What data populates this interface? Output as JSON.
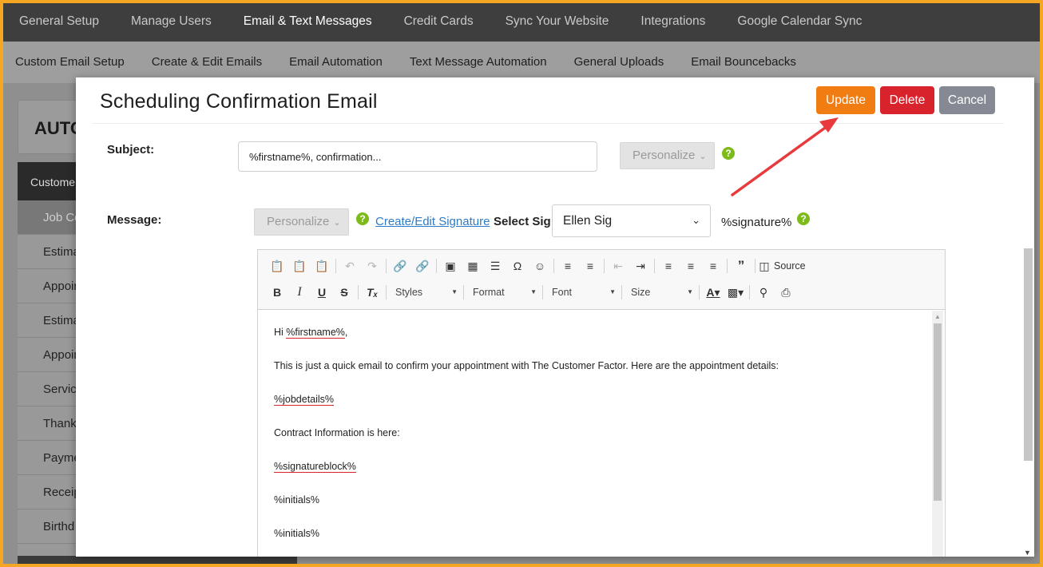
{
  "top_nav": {
    "items": [
      {
        "label": "General Setup"
      },
      {
        "label": "Manage Users"
      },
      {
        "label": "Email & Text Messages",
        "active": true
      },
      {
        "label": "Credit Cards"
      },
      {
        "label": "Sync Your Website"
      },
      {
        "label": "Integrations"
      },
      {
        "label": "Google Calendar Sync"
      }
    ]
  },
  "sub_nav": {
    "items": [
      {
        "label": "Custom Email Setup"
      },
      {
        "label": "Create & Edit Emails"
      },
      {
        "label": "Email Automation"
      },
      {
        "label": "Text Message Automation"
      },
      {
        "label": "General Uploads"
      },
      {
        "label": "Email Bouncebacks"
      }
    ]
  },
  "background": {
    "card_title": "AUTO",
    "sidebar_header": "Custome",
    "sidebar_items": [
      "Job Co",
      "Estima",
      "Appoin",
      "Estima",
      "Appoin",
      "Servic",
      "Thank",
      "Payme",
      "Receip",
      "Birthd"
    ]
  },
  "modal": {
    "title": "Scheduling Confirmation Email",
    "buttons": {
      "update": "Update",
      "delete": "Delete",
      "cancel": "Cancel"
    },
    "subject": {
      "label": "Subject:",
      "value": "%firstname%, confirmation...",
      "personalize_label": "Personalize"
    },
    "message": {
      "label": "Message:",
      "personalize_label": "Personalize",
      "signature_link": "Create/Edit Signature",
      "select_sig_label": "Select Sig",
      "selected_signature": "Ellen Sig",
      "signature_token": "%signature%"
    },
    "help_glyph": "?",
    "editor": {
      "toolbar": {
        "styles": "Styles",
        "format": "Format",
        "font": "Font",
        "size": "Size",
        "source": "Source"
      },
      "lines": {
        "greeting_prefix": "Hi ",
        "greeting_token": "%firstname%",
        "greeting_suffix": ",",
        "line2": "This is just a quick email to confirm your appointment with The Customer Factor. Here are the appointment details:",
        "line3_token": "%jobdetails%",
        "line4": "Contract Information is here:",
        "line5_token": "%signatureblock%",
        "line6": "%initials%",
        "line7": "%initials%"
      }
    }
  },
  "colors": {
    "update": "#f07c12",
    "delete": "#d9232c",
    "cancel": "#848993",
    "help": "#7dbb1a",
    "link": "#2e7bc6",
    "annotation_arrow": "#e8393c",
    "frame": "#f5a623"
  }
}
